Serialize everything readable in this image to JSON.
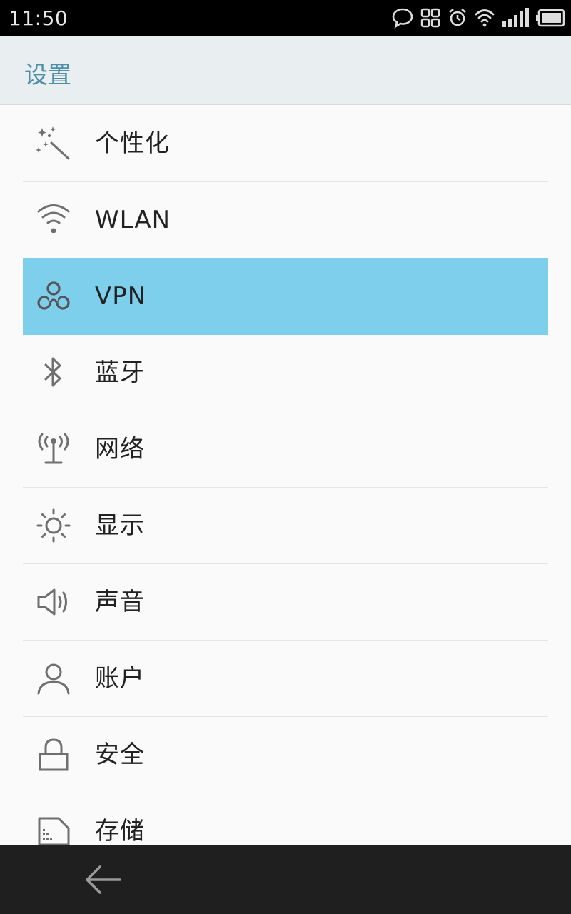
{
  "status_bar": {
    "time": "11:50",
    "icons": [
      "chat-bubble-icon",
      "apps-icon",
      "alarm-icon",
      "wifi-icon",
      "signal-icon",
      "battery-icon"
    ]
  },
  "header": {
    "title": "设置"
  },
  "settings": {
    "selected": "VPN",
    "highlight_color": "#7ecfec",
    "items": [
      {
        "label": "个性化",
        "icon": "magic-wand-icon"
      },
      {
        "label": "WLAN",
        "icon": "wifi-icon"
      },
      {
        "label": "VPN",
        "icon": "vpn-icon"
      },
      {
        "label": "蓝牙",
        "icon": "bluetooth-icon"
      },
      {
        "label": "网络",
        "icon": "antenna-icon"
      },
      {
        "label": "显示",
        "icon": "sun-icon"
      },
      {
        "label": "声音",
        "icon": "speaker-icon"
      },
      {
        "label": "账户",
        "icon": "user-icon"
      },
      {
        "label": "安全",
        "icon": "lock-icon"
      },
      {
        "label": "存储",
        "icon": "sd-card-icon"
      }
    ]
  },
  "nav_bar": {
    "back_icon": "back-arrow-icon"
  }
}
